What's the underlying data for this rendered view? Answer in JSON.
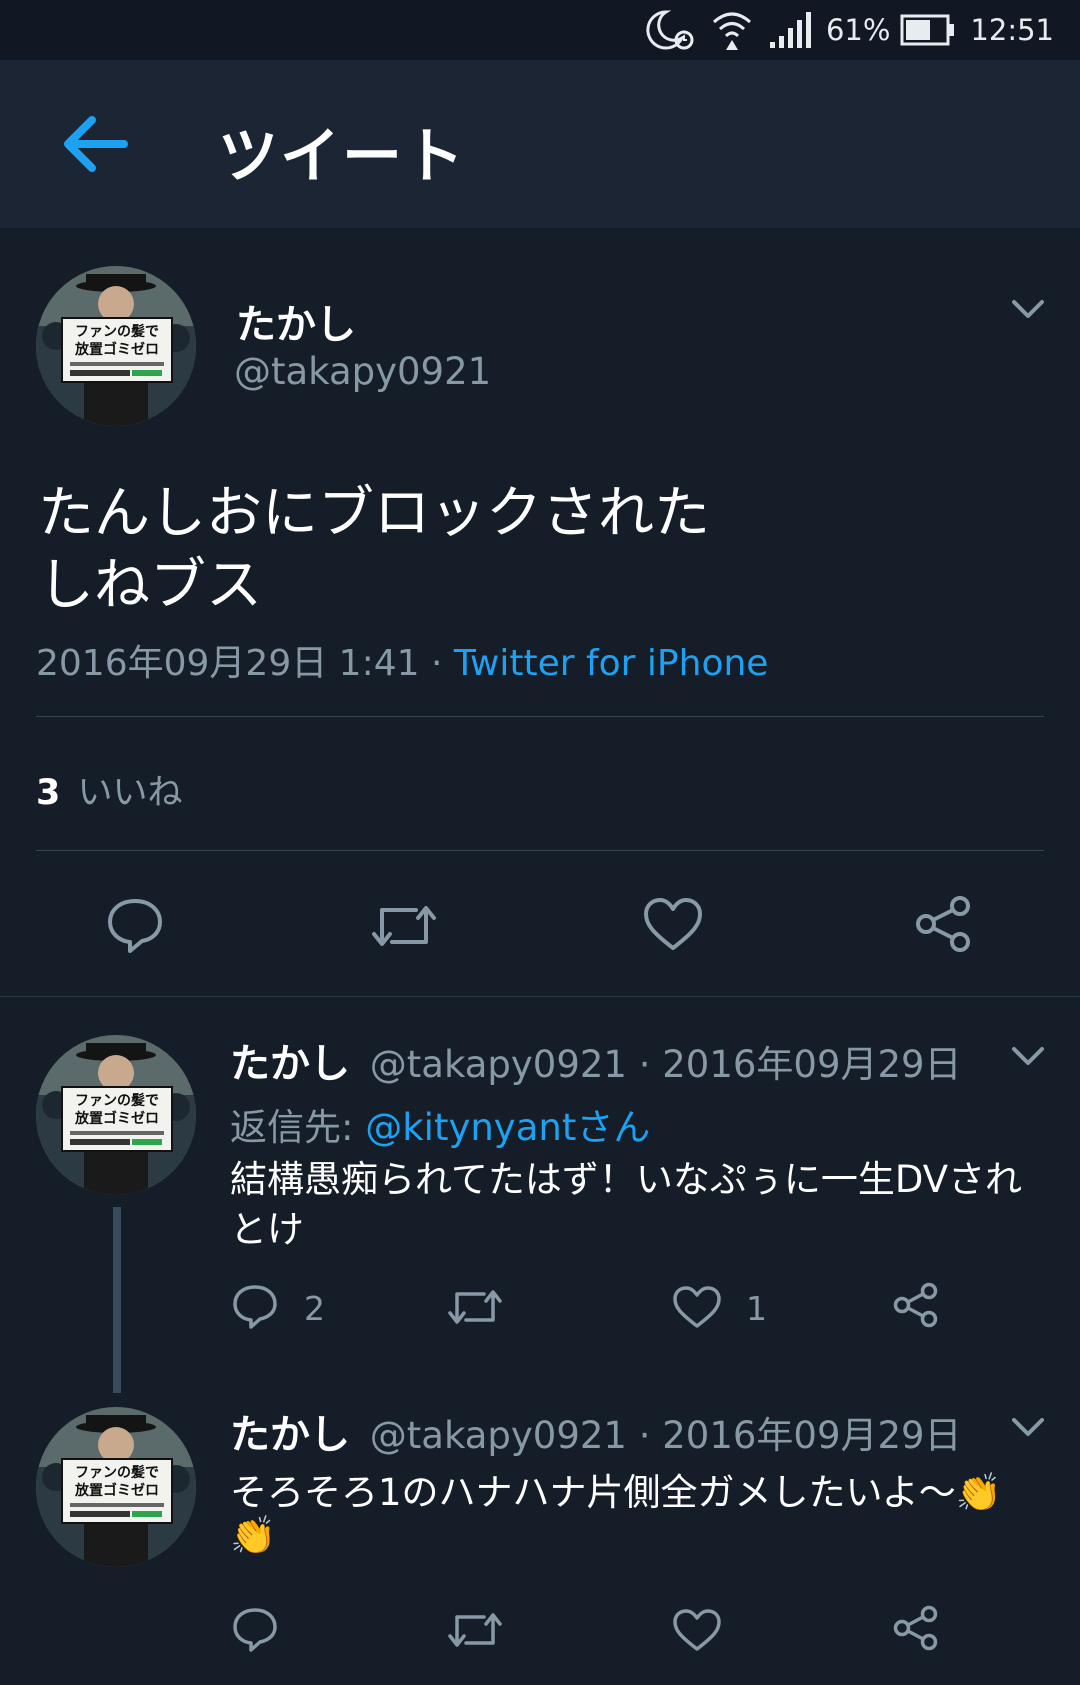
{
  "status_bar": {
    "battery_pct": "61%",
    "time": "12:51"
  },
  "header": {
    "title": "ツイート"
  },
  "main_tweet": {
    "name": "たかし",
    "handle": "@takapy0921",
    "text_line1": "たんしおにブロックされた",
    "text_line2": "しねブス",
    "timestamp": "2016年09月29日 1:41",
    "separator": " · ",
    "client": "Twitter for iPhone",
    "likes_count": "3",
    "likes_label": "いいね"
  },
  "replies": [
    {
      "name": "たかし",
      "handle": "@takapy0921",
      "date": " · 2016年09月29日",
      "reply_to_label": "返信先: ",
      "reply_to_user": "@kitynyantさん",
      "text_line1": "結構愚痴られてたはず！いなぷぅに一生DVされ",
      "text_line2": "とけ",
      "reply_count": "2",
      "like_count": "1"
    },
    {
      "name": "たかし",
      "handle": "@takapy0921",
      "date": " · 2016年09月29日",
      "text_line1": "そろそろ1のハナハナ片側全ガメしたいよ〜👏",
      "text_line2": "👏"
    }
  ],
  "avatar_sign": {
    "line1": "ファンの髪で",
    "line2": "放置ゴミゼロ"
  },
  "colors": {
    "background": "#151d28",
    "header": "#1b2533",
    "accent": "#1da1f2",
    "secondary_text": "#8899a6"
  },
  "icons": [
    "moon-alarm-icon",
    "wifi-icon",
    "signal-icon",
    "battery-icon",
    "back-arrow-icon",
    "chevron-down-icon",
    "reply-icon",
    "retweet-icon",
    "like-icon",
    "share-icon"
  ]
}
